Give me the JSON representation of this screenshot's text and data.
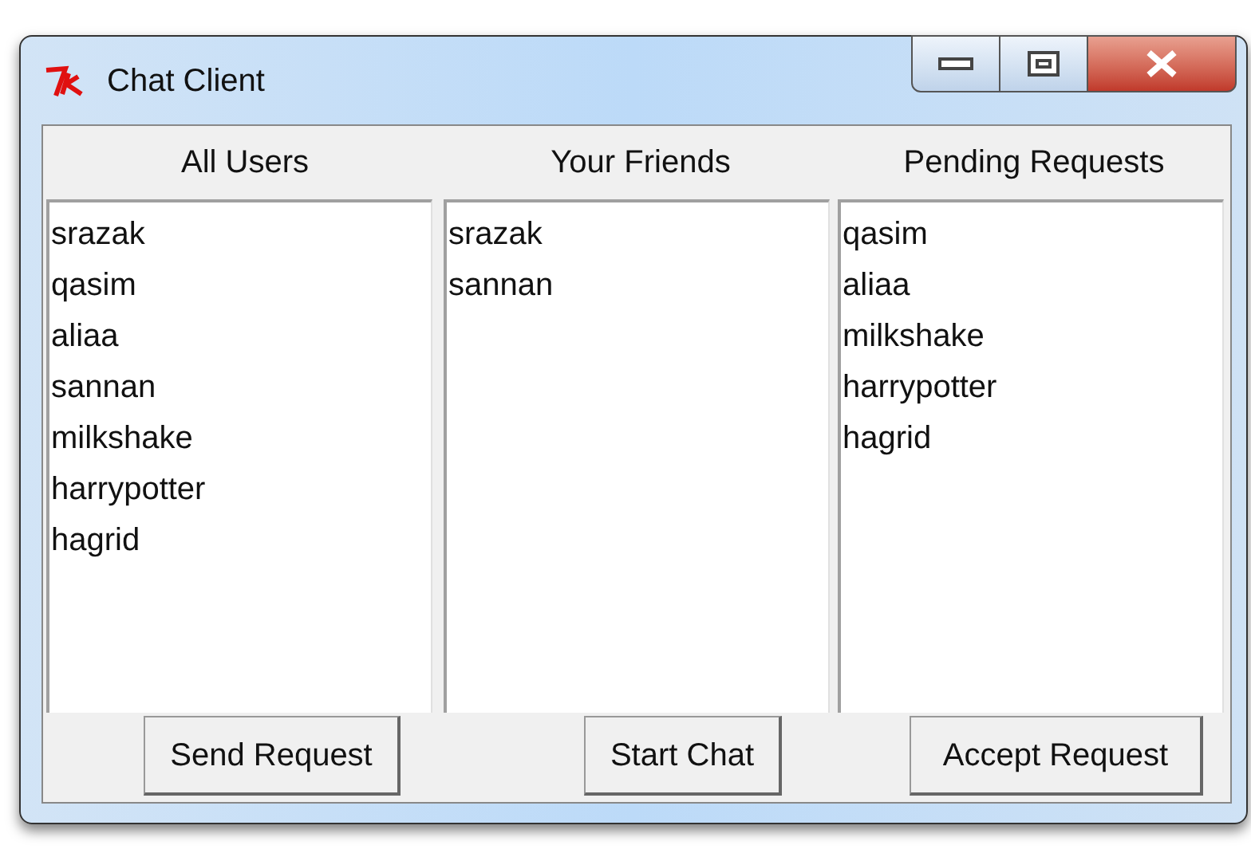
{
  "window": {
    "title": "Chat Client"
  },
  "columns": [
    {
      "heading": "All Users",
      "items": [
        "srazak",
        "qasim",
        "aliaa",
        "sannan",
        "milkshake",
        "harrypotter",
        "hagrid"
      ],
      "button": "Send Request"
    },
    {
      "heading": "Your Friends",
      "items": [
        "srazak",
        "sannan"
      ],
      "button": "Start Chat"
    },
    {
      "heading": "Pending Requests",
      "items": [
        "qasim",
        "aliaa",
        "milkshake",
        "harrypotter",
        "hagrid"
      ],
      "button": "Accept Request"
    }
  ]
}
